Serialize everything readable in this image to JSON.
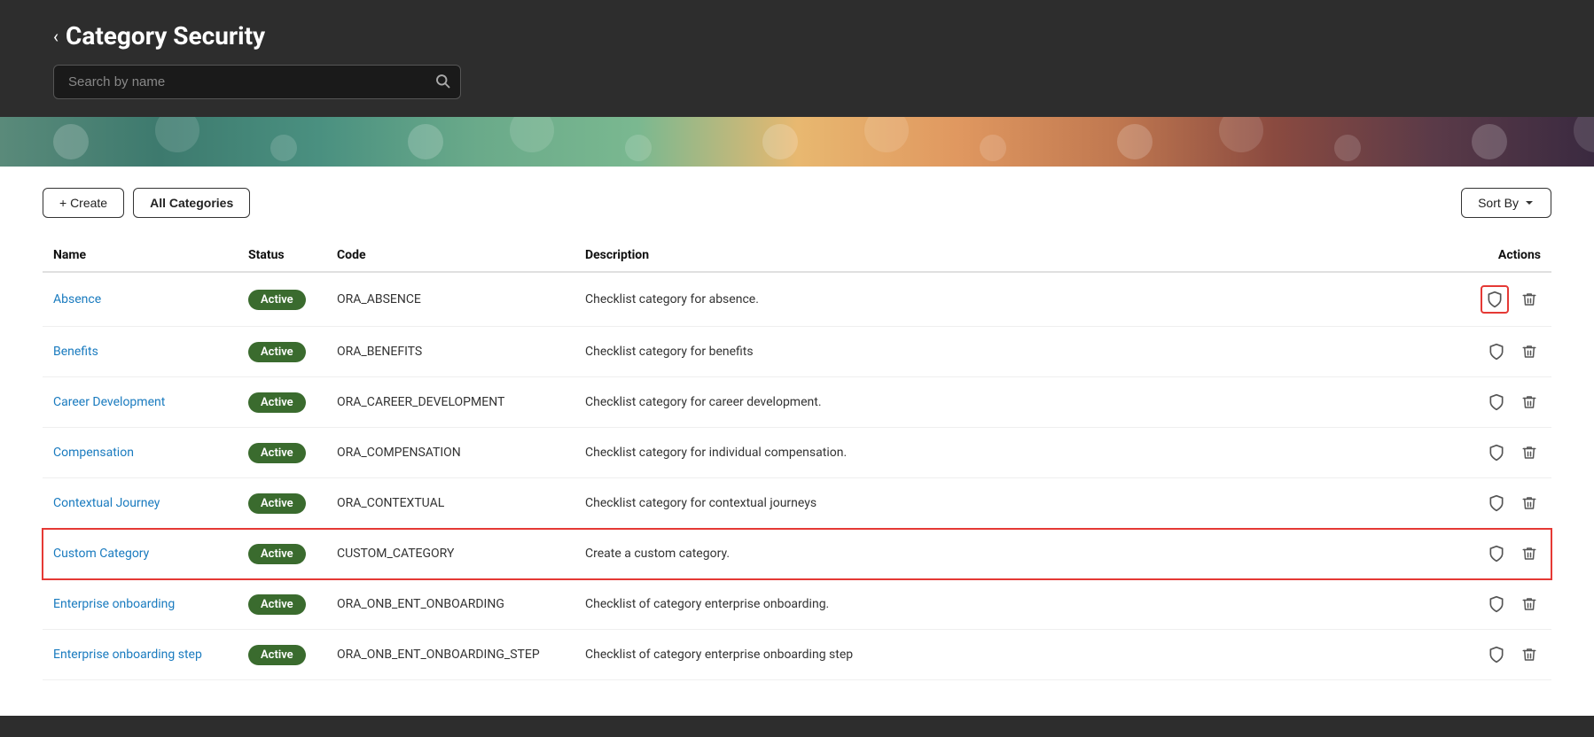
{
  "header": {
    "back_label": "‹",
    "title": "Category Security",
    "search_placeholder": "Search by name"
  },
  "toolbar": {
    "create_label": "+ Create",
    "all_categories_label": "All Categories",
    "sort_by_label": "Sort By"
  },
  "table": {
    "columns": {
      "name": "Name",
      "status": "Status",
      "code": "Code",
      "description": "Description",
      "actions": "Actions"
    },
    "rows": [
      {
        "name": "Absence",
        "status": "Active",
        "code": "ORA_ABSENCE",
        "description": "Checklist category for absence.",
        "shield_highlighted": true,
        "row_highlighted": false
      },
      {
        "name": "Benefits",
        "status": "Active",
        "code": "ORA_BENEFITS",
        "description": "Checklist category for benefits",
        "shield_highlighted": false,
        "row_highlighted": false
      },
      {
        "name": "Career Development",
        "status": "Active",
        "code": "ORA_CAREER_DEVELOPMENT",
        "description": "Checklist category for career development.",
        "shield_highlighted": false,
        "row_highlighted": false
      },
      {
        "name": "Compensation",
        "status": "Active",
        "code": "ORA_COMPENSATION",
        "description": "Checklist category for individual compensation.",
        "shield_highlighted": false,
        "row_highlighted": false
      },
      {
        "name": "Contextual Journey",
        "status": "Active",
        "code": "ORA_CONTEXTUAL",
        "description": "Checklist category for contextual journeys",
        "shield_highlighted": false,
        "row_highlighted": false
      },
      {
        "name": "Custom Category",
        "status": "Active",
        "code": "CUSTOM_CATEGORY",
        "description": "Create a custom category.",
        "shield_highlighted": false,
        "row_highlighted": true
      },
      {
        "name": "Enterprise onboarding",
        "status": "Active",
        "code": "ORA_ONB_ENT_ONBOARDING",
        "description": "Checklist of category enterprise onboarding.",
        "shield_highlighted": false,
        "row_highlighted": false
      },
      {
        "name": "Enterprise onboarding step",
        "status": "Active",
        "code": "ORA_ONB_ENT_ONBOARDING_STEP",
        "description": "Checklist of category enterprise onboarding step",
        "shield_highlighted": false,
        "row_highlighted": false
      }
    ]
  }
}
